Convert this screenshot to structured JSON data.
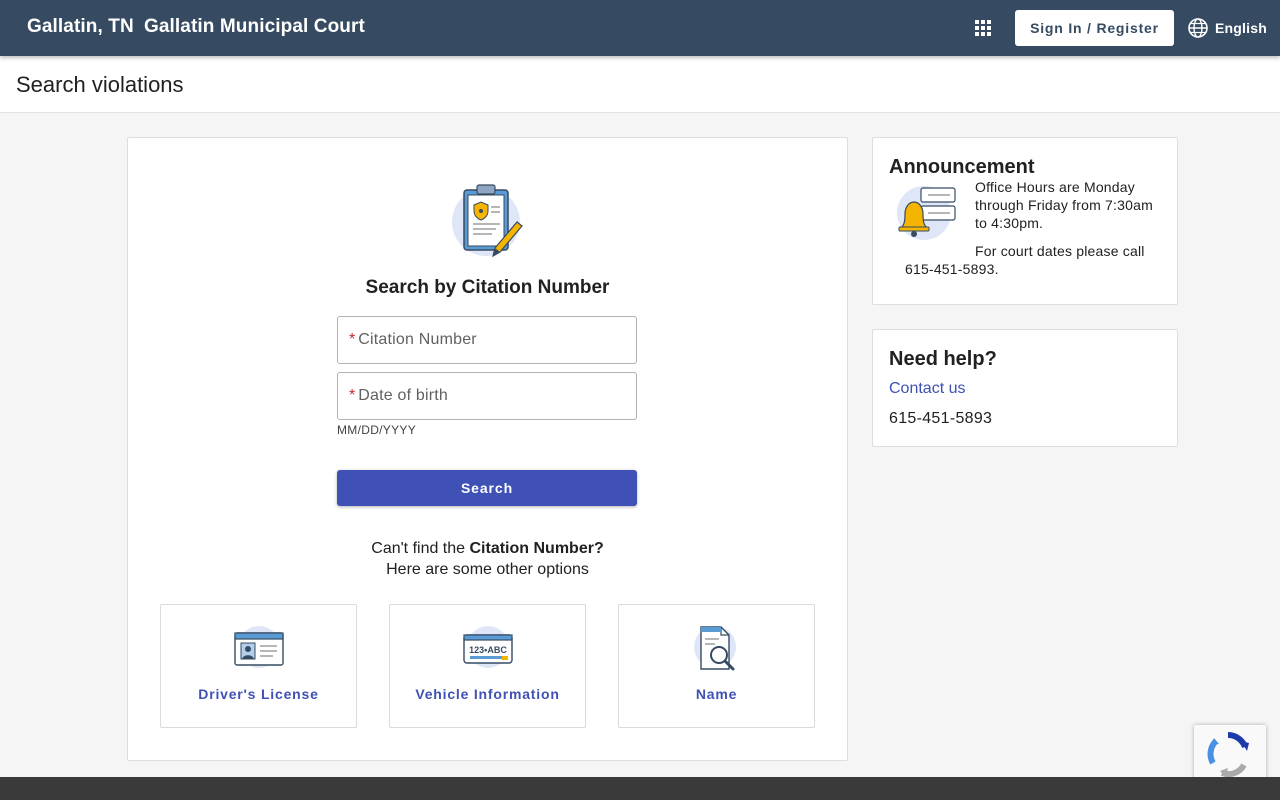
{
  "header": {
    "city": "Gallatin, TN",
    "court_name": "Gallatin Municipal Court",
    "sign_in_label": "Sign In / Register",
    "language_label": "English",
    "icons": {
      "apps": "apps-grid-icon",
      "language": "globe-icon"
    }
  },
  "page": {
    "title": "Search violations"
  },
  "search": {
    "heading": "Search by Citation Number",
    "citation_field": {
      "required_marker": "*",
      "placeholder": "Citation Number"
    },
    "dob_field": {
      "required_marker": "*",
      "placeholder": "Date of birth",
      "hint": "MM/DD/YYYY"
    },
    "search_button": "Search",
    "cant_find_prefix": "Can't find the ",
    "cant_find_bold": "Citation Number?",
    "other_options": "Here are some other options",
    "options": [
      {
        "label": "Driver's License",
        "icon": "drivers-license-icon"
      },
      {
        "label": "Vehicle Information",
        "icon": "license-plate-icon",
        "plate_text": "123•ABC"
      },
      {
        "label": "Name",
        "icon": "name-search-icon"
      }
    ]
  },
  "announcement": {
    "title": "Announcement",
    "line1": "Office Hours are Monday through Friday from 7:30am to 4:30pm.",
    "line2": "For court dates please call 615-451-5893."
  },
  "help": {
    "title": "Need help?",
    "contact_label": "Contact us",
    "phone": "615-451-5893"
  },
  "colors": {
    "header_bg": "#364b62",
    "accent": "#3f51b5",
    "required": "#c62828",
    "footer_bg": "#3a3a3a"
  }
}
